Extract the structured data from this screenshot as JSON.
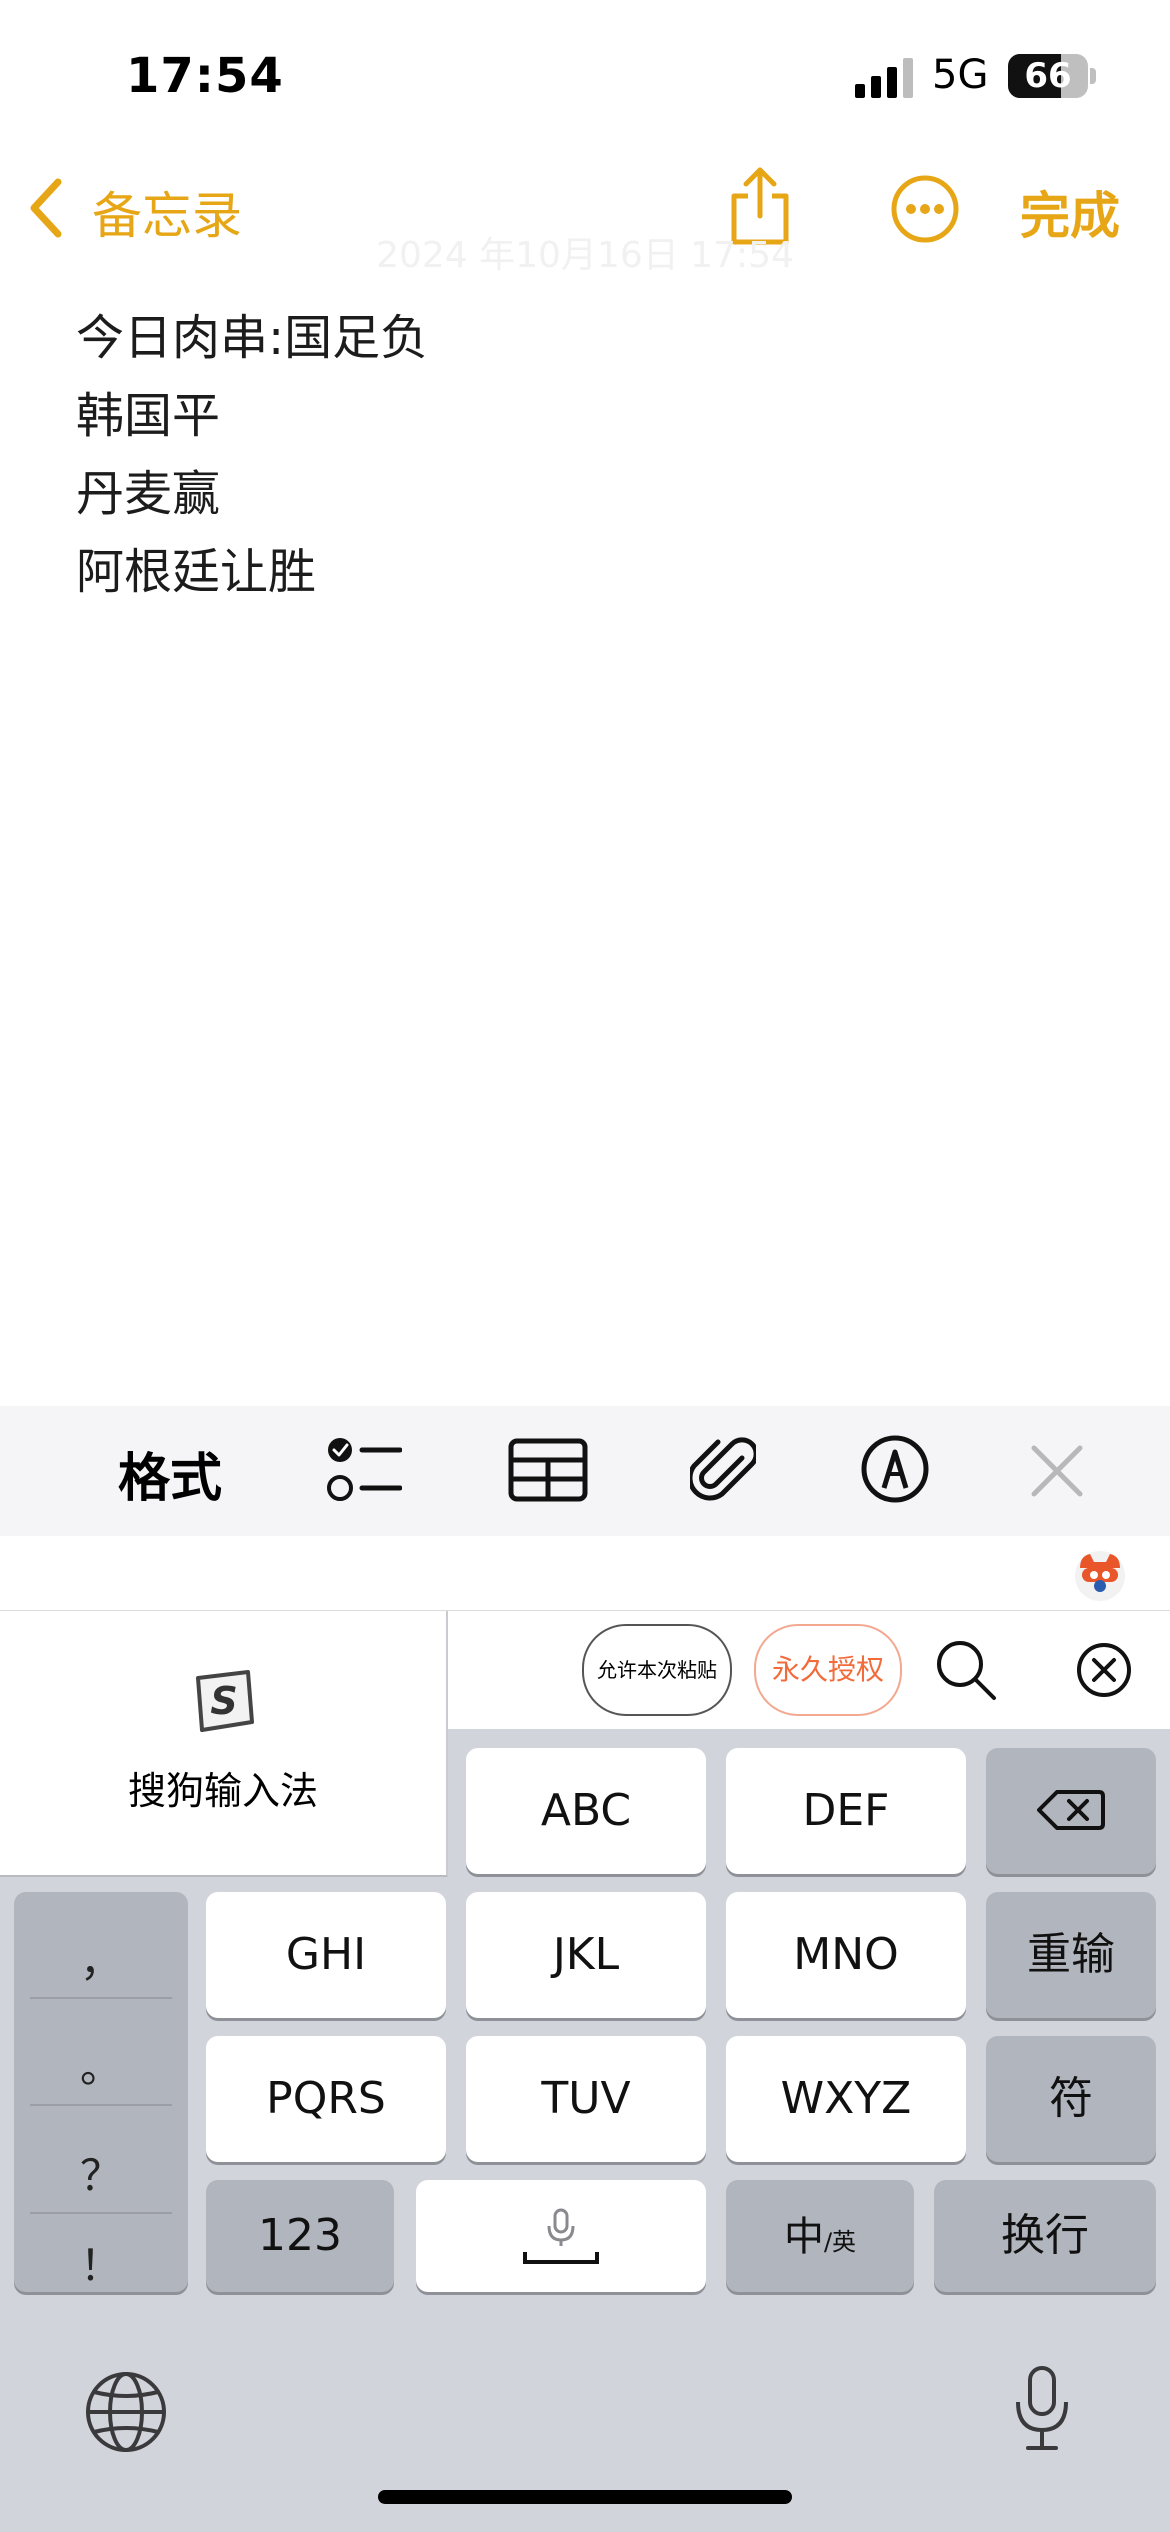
{
  "status_bar": {
    "time": "17:54",
    "network": "5G",
    "battery_percent": "66",
    "battery_level": 0.66,
    "signal_bars": 3
  },
  "nav": {
    "back_label": "备忘录",
    "done_label": "完成",
    "date_ghost": "2024 年10月16日 17:54"
  },
  "note": {
    "lines": [
      "今日肉串:国足负",
      "韩国平",
      "丹麦赢",
      "阿根廷让胜"
    ]
  },
  "format_toolbar": {
    "format_label": "格式"
  },
  "ime": {
    "name": "搜狗输入法",
    "paste_once": "允许本次粘贴",
    "paste_forever": "永久授权",
    "keys": {
      "row1": [
        "ABC",
        "DEF"
      ],
      "row2": [
        "GHI",
        "JKL",
        "MNO"
      ],
      "row3": [
        "PQRS",
        "TUV",
        "WXYZ"
      ],
      "reinput": "重输",
      "symbol": "符",
      "numbers": "123",
      "lang_main": "中",
      "lang_sub": "/英",
      "newline": "换行"
    },
    "punctuation": [
      "，",
      "。",
      "？",
      "！"
    ]
  },
  "colors": {
    "accent": "#E6A615",
    "keyboard_bg": "#D1D4DB",
    "grant_orange": "#F26B3A"
  }
}
